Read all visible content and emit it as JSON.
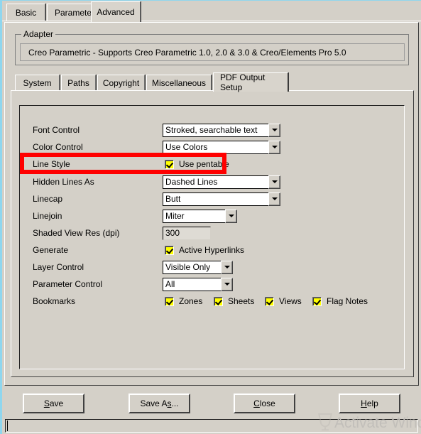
{
  "outer_tabs": [
    {
      "label": "Basic",
      "active": false
    },
    {
      "label": "Parameters",
      "active": false
    },
    {
      "label": "Advanced",
      "active": true
    }
  ],
  "adapter_group": {
    "title": "Adapter",
    "value": "Creo Parametric  -  Supports Creo Parametric 1.0, 2.0 & 3.0 & Creo/Elements Pro 5.0"
  },
  "inner_tabs": [
    {
      "label": "System",
      "active": false
    },
    {
      "label": "Paths",
      "active": false
    },
    {
      "label": "Copyright",
      "active": false
    },
    {
      "label": "Miscellaneous",
      "active": false
    },
    {
      "label": "PDF Output Setup",
      "active": true
    }
  ],
  "form": {
    "font_control": {
      "label": "Font Control",
      "value": "Stroked, searchable text"
    },
    "color_control": {
      "label": "Color Control",
      "value": "Use Colors"
    },
    "line_style": {
      "label": "Line Style",
      "checkbox_label": "Use pentable",
      "checked": true
    },
    "hidden_lines_as": {
      "label": "Hidden Lines As",
      "value": "Dashed Lines"
    },
    "linecap": {
      "label": "Linecap",
      "value": "Butt"
    },
    "linejoin": {
      "label": "Linejoin",
      "value": "Miter"
    },
    "shaded_view_res": {
      "label": "Shaded View Res (dpi)",
      "value": "300"
    },
    "generate": {
      "label": "Generate",
      "checkbox_label": "Active Hyperlinks",
      "checked": true
    },
    "layer_control": {
      "label": "Layer Control",
      "value": "Visible Only"
    },
    "parameter_control": {
      "label": "Parameter Control",
      "value": "All"
    },
    "bookmarks": {
      "label": "Bookmarks",
      "options": [
        {
          "label": "Zones",
          "checked": true
        },
        {
          "label": "Sheets",
          "checked": true
        },
        {
          "label": "Views",
          "checked": true
        },
        {
          "label": "Flag Notes",
          "checked": true
        }
      ]
    }
  },
  "buttons": {
    "save": {
      "pre": "",
      "mnemonic": "S",
      "post": "ave"
    },
    "save_as": {
      "pre": "Save A",
      "mnemonic": "s",
      "post": "..."
    },
    "close": {
      "pre": "",
      "mnemonic": "C",
      "post": "lose"
    },
    "help": {
      "pre": "",
      "mnemonic": "H",
      "post": "elp"
    }
  },
  "statusbar": {
    "text": ""
  },
  "watermark": {
    "text": "Activate Windo"
  },
  "colors": {
    "face": "#d4d0c8",
    "highlight_red": "#ff0000",
    "checkbox_yellow": "#ffff00",
    "accent_blue": "#8fd6ee"
  }
}
